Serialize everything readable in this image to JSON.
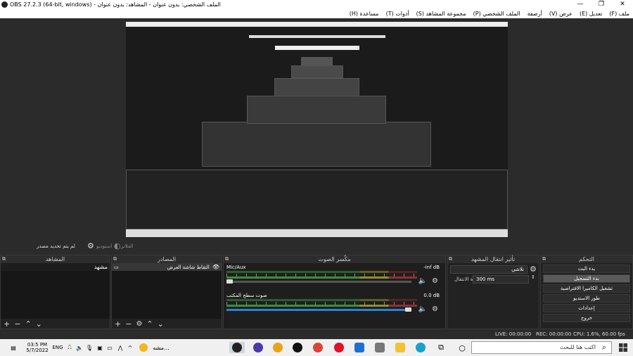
{
  "window": {
    "title": "OBS 27.2.3 (64-bit, windows) - الملف الشخصي: بدون عنوان - المشاهد: بدون عنوان",
    "minimize": "—",
    "maximize": "❐",
    "close": "✕"
  },
  "menu": [
    "ملف (F)",
    "تعديل (E)",
    "عرض (V)",
    "أرصفة",
    "الملف الشخصي (P)",
    "مجموعة المشاهد (S)",
    "أدوات (T)",
    "مساعدة (H)"
  ],
  "status_top": {
    "studio_mode": "استوديو",
    "no_scene": "لم يتم تحديد مصدر",
    "filters": "الفلاتر"
  },
  "scenes": {
    "title": "المشاهد",
    "items": [
      "مشهد"
    ]
  },
  "sources": {
    "title": "المصادر",
    "items": [
      {
        "label": "التقاط شاشة العرض",
        "visible": true
      }
    ]
  },
  "mixer": {
    "title": "مكّسر الصوت",
    "tracks": [
      {
        "name": "Mic/Aux",
        "db": "-inf dB",
        "level": 0.03
      },
      {
        "name": "صوت سطح المكتب",
        "db": "0.0 dB",
        "level": 1.0
      }
    ]
  },
  "transitions": {
    "title": "تأثير انتقال المشهد",
    "selected": "تلاشي",
    "duration_label": "مدة الانتقال",
    "duration": "300 ms"
  },
  "controls": {
    "title": "التحكم",
    "buttons": [
      "بدء البث",
      "بدء التسجيل",
      "تشغيل الكاميرا الافتراضية",
      "طور الاستديو",
      "إعدادات",
      "خروج"
    ],
    "highlighted": 1
  },
  "statusbar": {
    "live": "LIVE: 00:00:00",
    "rec": "REC: 00:00:00",
    "cpu": "CPU: 1.6%, 60.00 fps"
  },
  "taskbar": {
    "search_placeholder": "اكتب هنا للبحث",
    "time": "03:5 PM",
    "date": "5/7/2022",
    "lang": "ENG",
    "pinned_label": "مشه..."
  },
  "colors": {
    "accent": "#2a82da",
    "panel": "#222222",
    "highlight": "#5a5a5a"
  }
}
